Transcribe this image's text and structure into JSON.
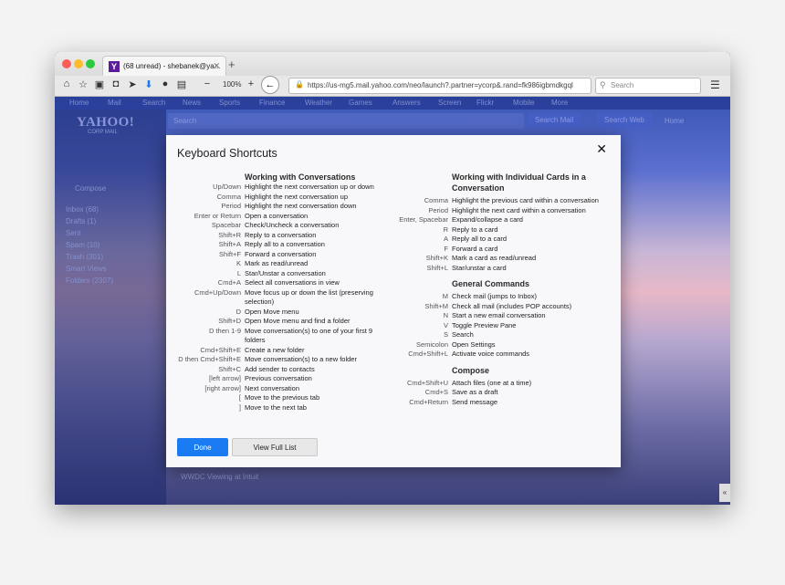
{
  "browser": {
    "tab_title": "(68 unread) - shebanek@ya...",
    "tab_favicon": "Y",
    "zoom": "100%",
    "url": "https://us-mg5.mail.yahoo.com/neo/launch?.partner=ycorp&.rand=fk986igbmdkgql",
    "search_placeholder": "Search"
  },
  "mail_bg": {
    "nav": [
      "Home",
      "Mail",
      "Search",
      "News",
      "Sports",
      "Finance",
      "Weather",
      "Games",
      "Answers",
      "Screen",
      "Flickr",
      "Mobile",
      "More"
    ],
    "logo": "YAHOO!",
    "logo_sub": "CORP MAIL",
    "top_search": "Search",
    "search_mail": "Search Mail",
    "search_web": "Search Web",
    "home": "Home",
    "compose": "Compose",
    "folders": [
      "Inbox (68)",
      "Drafts (1)",
      "Sent",
      "Spam (10)",
      "Trash (301)",
      "Smart Views",
      "Folders (2307)"
    ],
    "bottom": "WWDC Viewing at Intuit"
  },
  "modal": {
    "title": "Keyboard Shortcuts",
    "close": "✕",
    "col1": {
      "heading": "Working with Conversations",
      "rows": [
        {
          "k": "Up/Down",
          "d": "Highlight the next conversation up or down"
        },
        {
          "k": "Comma",
          "d": "Highlight the next conversation up"
        },
        {
          "k": "Period",
          "d": "Highlight the next conversation down"
        },
        {
          "k": "Enter or Return",
          "d": "Open a conversation"
        },
        {
          "k": "Spacebar",
          "d": "Check/Uncheck a conversation"
        },
        {
          "k": "Shift+R",
          "d": "Reply to a conversation"
        },
        {
          "k": "Shift+A",
          "d": "Reply all to a conversation"
        },
        {
          "k": "Shift+F",
          "d": "Forward a conversation"
        },
        {
          "k": "K",
          "d": "Mark as read/unread"
        },
        {
          "k": "L",
          "d": "Star/Unstar a conversation"
        },
        {
          "k": "Cmd+A",
          "d": "Select all conversations in view"
        },
        {
          "k": "Cmd+Up/Down",
          "d": "Move focus up or down the list (preserving selection)"
        },
        {
          "k": "D",
          "d": "Open Move menu"
        },
        {
          "k": "Shift+D",
          "d": "Open Move menu and find a folder"
        },
        {
          "k": "D then 1-9",
          "d": "Move conversation(s) to one of your first 9 folders"
        },
        {
          "k": "Cmd+Shift+E",
          "d": "Create a new folder"
        },
        {
          "k": "D then Cmd+Shift+E",
          "d": "Move conversation(s) to a new folder"
        },
        {
          "k": "Shift+C",
          "d": "Add sender to contacts"
        },
        {
          "k": "[left arrow]",
          "d": "Previous conversation"
        },
        {
          "k": "[right arrow]",
          "d": "Next conversation"
        },
        {
          "k": "[",
          "d": "Move to the previous tab"
        },
        {
          "k": "]",
          "d": "Move to the next tab"
        }
      ]
    },
    "col2": {
      "sections": [
        {
          "heading": "Working with Individual Cards in a Conversation",
          "rows": [
            {
              "k": "Comma",
              "d": "Highlight the previous card within a conversation"
            },
            {
              "k": "Period",
              "d": "Highlight the next card within a conversation"
            },
            {
              "k": "Enter, Spacebar",
              "d": "Expand/collapse a card"
            },
            {
              "k": "R",
              "d": "Reply to a card"
            },
            {
              "k": "A",
              "d": "Reply all to a card"
            },
            {
              "k": "F",
              "d": "Forward a card"
            },
            {
              "k": "Shift+K",
              "d": "Mark a card as read/unread"
            },
            {
              "k": "Shift+L",
              "d": "Star/unstar a card"
            }
          ]
        },
        {
          "heading": "General Commands",
          "rows": [
            {
              "k": "M",
              "d": "Check mail (jumps to Inbox)"
            },
            {
              "k": "Shift+M",
              "d": "Check all mail (includes POP accounts)"
            },
            {
              "k": "N",
              "d": "Start a new email conversation"
            },
            {
              "k": "V",
              "d": "Toggle Preview Pane"
            },
            {
              "k": "S",
              "d": "Search"
            },
            {
              "k": "Semicolon",
              "d": "Open Settings"
            },
            {
              "k": "Cmd+Shift+L",
              "d": "Activate voice commands"
            }
          ]
        },
        {
          "heading": "Compose",
          "rows": [
            {
              "k": "Cmd+Shift+U",
              "d": "Attach files (one at a time)"
            },
            {
              "k": "Cmd+S",
              "d": "Save as a draft"
            },
            {
              "k": "Cmd+Return",
              "d": "Send message"
            }
          ]
        }
      ]
    },
    "done_label": "Done",
    "full_list_label": "View Full List"
  }
}
